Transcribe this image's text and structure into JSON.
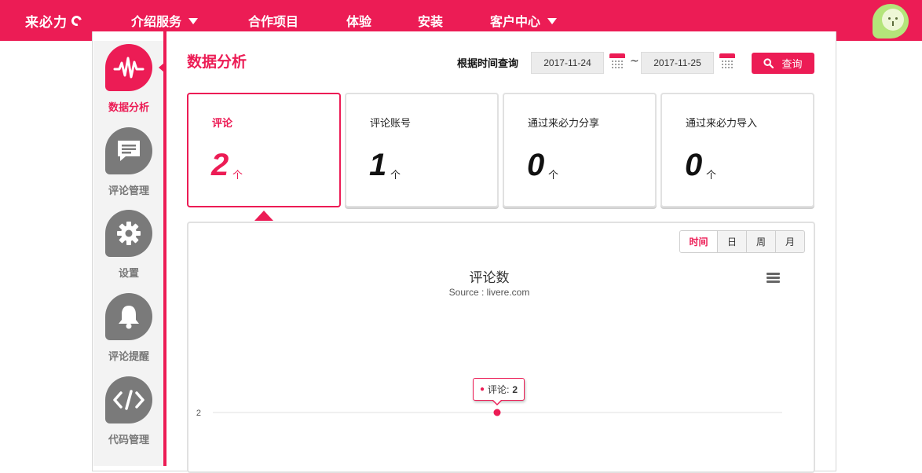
{
  "app": {
    "logo": "来必力"
  },
  "nav": {
    "items": [
      {
        "label": "介绍服务",
        "has_dropdown": true
      },
      {
        "label": "合作项目",
        "has_dropdown": false
      },
      {
        "label": "体验",
        "has_dropdown": false
      },
      {
        "label": "安装",
        "has_dropdown": false
      },
      {
        "label": "客户中心",
        "has_dropdown": true
      }
    ]
  },
  "sidebar": {
    "items": [
      {
        "label": "数据分析",
        "icon": "pulse-icon",
        "active": true
      },
      {
        "label": "评论管理",
        "icon": "comment-icon",
        "active": false
      },
      {
        "label": "设置",
        "icon": "gear-icon",
        "active": false
      },
      {
        "label": "评论提醒",
        "icon": "bell-icon",
        "active": false
      },
      {
        "label": "代码管理",
        "icon": "code-icon",
        "active": false
      }
    ]
  },
  "main": {
    "title": "数据分析",
    "query_label": "根据时间查询",
    "date_from": "2017-11-24",
    "date_separator": "~",
    "date_to": "2017-11-25",
    "search_label": "查询"
  },
  "stats": [
    {
      "label": "评论",
      "value": "2",
      "unit": "个",
      "active": true
    },
    {
      "label": "评论账号",
      "value": "1",
      "unit": "个",
      "active": false
    },
    {
      "label": "通过来必力分享",
      "value": "0",
      "unit": "个",
      "active": false
    },
    {
      "label": "通过来必力导入",
      "value": "0",
      "unit": "个",
      "active": false
    }
  ],
  "chart_tabs": [
    "时间",
    "日",
    "周",
    "月"
  ],
  "colors": {
    "accent": "#ec1c55",
    "avatar": "#b4e57a",
    "sidebar_icon": "#7a7a7a"
  },
  "chart_data": {
    "type": "line",
    "title": "评论数",
    "subtitle": "Source : livere.com",
    "y_ticks": [
      2
    ],
    "series": [
      {
        "name": "评论",
        "values": [
          2
        ]
      }
    ],
    "tooltip": {
      "series": "评论",
      "value": "2"
    }
  }
}
